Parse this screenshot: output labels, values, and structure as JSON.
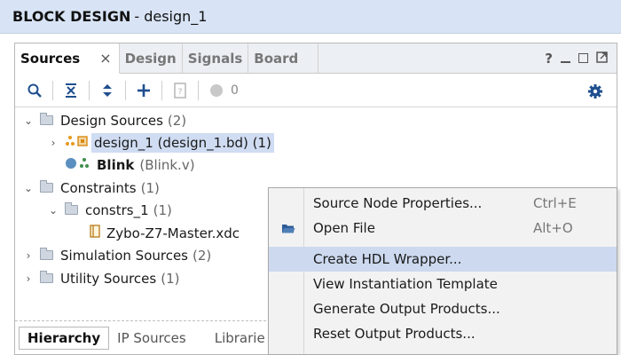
{
  "window": {
    "title_bold": "BLOCK DESIGN",
    "title_rest": "- design_1"
  },
  "tabs": [
    {
      "label": "Sources",
      "close": "×"
    },
    {
      "label": "Design"
    },
    {
      "label": "Signals"
    },
    {
      "label": "Board"
    }
  ],
  "tab_actions": {
    "help": "?"
  },
  "toolbar": {
    "count": "0"
  },
  "tree": {
    "design_sources": {
      "label": "Design Sources",
      "count": "(2)"
    },
    "design_1": {
      "label": "design_1 (design_1.bd) (1)"
    },
    "blink": {
      "name": "Blink",
      "file": "(Blink.v)"
    },
    "constraints": {
      "label": "Constraints",
      "count": "(1)"
    },
    "constrs_1": {
      "label": "constrs_1",
      "count": "(1)"
    },
    "xdc": {
      "label": "Zybo-Z7-Master.xdc"
    },
    "simulation_sources": {
      "label": "Simulation Sources",
      "count": "(2)"
    },
    "utility_sources": {
      "label": "Utility Sources",
      "count": "(1)"
    }
  },
  "bottom_tabs": [
    "Hierarchy",
    "IP Sources",
    "Librarie"
  ],
  "context_menu": {
    "items": [
      {
        "label": "Source Node Properties...",
        "shortcut": "Ctrl+E"
      },
      {
        "label": "Open File",
        "shortcut": "Alt+O"
      },
      {
        "label": "Create HDL Wrapper...",
        "shortcut": ""
      },
      {
        "label": "View Instantiation Template",
        "shortcut": ""
      },
      {
        "label": "Generate Output Products...",
        "shortcut": ""
      },
      {
        "label": "Reset Output Products...",
        "shortcut": ""
      }
    ],
    "highlighted_index": 2
  },
  "colors": {
    "title_bg": "#d8e4f5",
    "selection": "#cfdcf2",
    "accent": "#1f4f8f",
    "menu_highlight": "#ccd9ef"
  }
}
